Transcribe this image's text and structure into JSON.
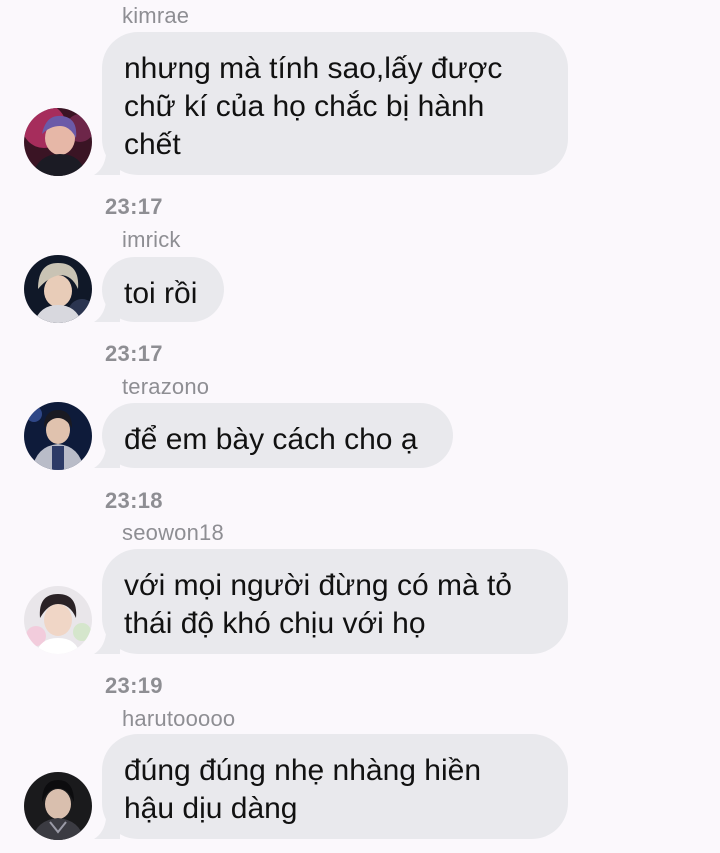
{
  "chat": {
    "messages": [
      {
        "sender": "kimrae",
        "lines": [
          "nhưng mà tính sao,lấy được",
          "chữ kí của họ chắc bị hành",
          "chết"
        ],
        "time": "23:17"
      },
      {
        "sender": "imrick",
        "lines": [
          "toi rồi"
        ],
        "time": "23:17"
      },
      {
        "sender": "terazono",
        "lines": [
          "để em bày cách cho ạ"
        ],
        "time": "23:18"
      },
      {
        "sender": "seowon18",
        "lines": [
          "với mọi người đừng có mà tỏ",
          "thái độ khó chịu với họ"
        ],
        "time": "23:19"
      },
      {
        "sender": "harutooooo",
        "lines": [
          "đúng đúng nhẹ nhàng hiền",
          "hậu dịu dàng"
        ]
      }
    ],
    "colors": {
      "background": "#fbf8fc",
      "bubble": "#e9e9ed",
      "meta_text": "#8e8e93",
      "message_text": "#111111"
    }
  }
}
